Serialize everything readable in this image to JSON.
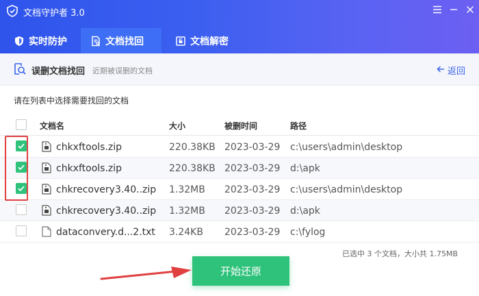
{
  "app": {
    "title": "文档守护者 3.0"
  },
  "tabs": [
    {
      "label": "实时防护",
      "icon": "shield-icon"
    },
    {
      "label": "文档找回",
      "icon": "file-search-icon",
      "active": true
    },
    {
      "label": "文档解密",
      "icon": "unlock-icon"
    }
  ],
  "subheader": {
    "title": "误删文档找回",
    "description": "近期被误删的文档",
    "back_label": "返回"
  },
  "instruction": "请在列表中选择需要找回的文档",
  "table": {
    "columns": [
      "文档名",
      "大小",
      "被删时间",
      "路径"
    ],
    "rows": [
      {
        "name": "chkxftools.zip",
        "size": "220.38KB",
        "date": "2023-03-29",
        "path": "c:\\users\\admin\\desktop",
        "checked": true,
        "type": "zip"
      },
      {
        "name": "chkxftools.zip",
        "size": "220.38KB",
        "date": "2023-03-29",
        "path": "d:\\apk",
        "checked": true,
        "type": "zip"
      },
      {
        "name": "chkrecovery3.40..zip",
        "size": "1.32MB",
        "date": "2023-03-29",
        "path": "c:\\users\\admin\\desktop",
        "checked": true,
        "type": "zip"
      },
      {
        "name": "chkrecovery3.40..zip",
        "size": "1.32MB",
        "date": "2023-03-29",
        "path": "d:\\apk",
        "checked": false,
        "type": "zip"
      },
      {
        "name": "dataconvery.d...2.txt",
        "size": "3.24KB",
        "date": "2023-03-29",
        "path": "c:\\fylog",
        "checked": false,
        "type": "txt"
      }
    ]
  },
  "summary": "已选中 3 个文档，大小共 1.75MB",
  "start_button": "开始还原",
  "colors": {
    "header_start": "#2f54eb",
    "header_end": "#6c5ff2",
    "active_tab": "#3e6ef5",
    "accent_green": "#2ec27a",
    "link_blue": "#3a64e8",
    "annotation_red": "#e04040"
  }
}
